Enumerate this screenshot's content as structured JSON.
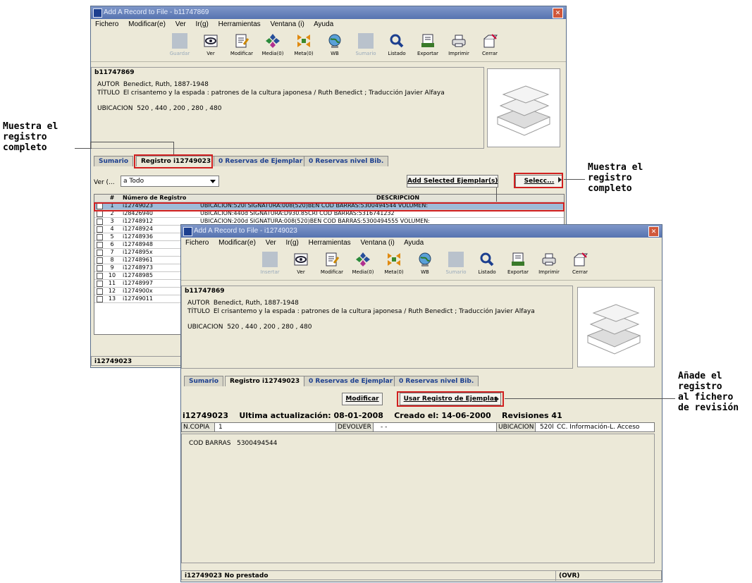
{
  "window1": {
    "title": "Add A Record to File - b11747869",
    "menu": [
      "Fichero",
      "Modificar(e)",
      "Ver",
      "Ir(g)",
      "Herramientas",
      "Ventana (i)",
      "Ayuda"
    ],
    "toolbar": [
      "Guardar",
      "Ver",
      "Modificar",
      "Media(0)",
      "Meta(0)",
      "WB",
      "Sumario",
      "Listado",
      "Exportar",
      "Imprimir",
      "Cerrar"
    ],
    "record_id": "b11747869",
    "autor_label": "AUTOR",
    "autor": "Benedict, Ruth, 1887-1948",
    "titulo_label": "TÍTULO",
    "titulo": "El crisantemo y la espada : patrones de la cultura japonesa / Ruth Benedict ; Traducción Javier Alfaya",
    "ubicacion_label": "UBICACION",
    "ubicacion": "520 , 440 , 200 , 280 , 480",
    "tabs": [
      "Sumario",
      "Registro i12749023",
      "0 Reservas de Ejemplar",
      "0 Reservas nivel Bib."
    ],
    "view_label": "Ver (...",
    "view_value": "a Todo",
    "add_button": "Add Selected Ejemplar(s)",
    "select_button": "Selecc...",
    "table_headers": {
      "num": "#",
      "record": "Número de Registro",
      "desc": "DESCRIPCION"
    },
    "rows": [
      {
        "num": "1",
        "record": "i12749023",
        "desc": "UBICACION:520l  SIGNATURA:008(520)BEN COD BARRAS:5300494544 VOLUMEN:"
      },
      {
        "num": "2",
        "record": "i28426940",
        "desc": "UBICACION:440d  SIGNATURA:D930.85CRI COD BARRAS:5316741232"
      },
      {
        "num": "3",
        "record": "i12748912",
        "desc": "UBICACION:200d  SIGNATURA:008(520)BEN COD BARRAS:5300494555 VOLUMEN:"
      },
      {
        "num": "4",
        "record": "i12748924",
        "desc": ""
      },
      {
        "num": "5",
        "record": "i12748936",
        "desc": ""
      },
      {
        "num": "6",
        "record": "i12748948",
        "desc": ""
      },
      {
        "num": "7",
        "record": "i1274895x",
        "desc": ""
      },
      {
        "num": "8",
        "record": "i12748961",
        "desc": ""
      },
      {
        "num": "9",
        "record": "i12748973",
        "desc": ""
      },
      {
        "num": "10",
        "record": "i12748985",
        "desc": ""
      },
      {
        "num": "11",
        "record": "i12748997",
        "desc": ""
      },
      {
        "num": "12",
        "record": "i1274900x",
        "desc": ""
      },
      {
        "num": "13",
        "record": "i12749011",
        "desc": ""
      }
    ],
    "status": "i12749023"
  },
  "window2": {
    "title": "Add A Record to File - i12749023",
    "menu": [
      "Fichero",
      "Modificar(e)",
      "Ver",
      "Ir(g)",
      "Herramientas",
      "Ventana (i)",
      "Ayuda"
    ],
    "toolbar": [
      "Insertar",
      "Ver",
      "Modificar",
      "Media(0)",
      "Meta(0)",
      "WB",
      "Sumario",
      "Listado",
      "Exportar",
      "Imprimir",
      "Cerrar"
    ],
    "record_id": "b11747869",
    "autor_label": "AUTOR",
    "autor": "Benedict, Ruth, 1887-1948",
    "titulo_label": "TÍTULO",
    "titulo": "El crisantemo y la espada : patrones de la cultura japonesa / Ruth Benedict ; Traducción Javier Alfaya",
    "ubicacion_label": "UBICACION",
    "ubicacion": "520 , 440 , 200 , 280 , 480",
    "tabs": [
      "Sumario",
      "Registro i12749023",
      "0 Reservas de Ejemplar",
      "0 Reservas nivel Bib."
    ],
    "modify_button": "Modificar",
    "use_button": "Usar Registro de Ejemplar",
    "item_id": "i12749023",
    "last_update": "Ultima actualización: 08-01-2008",
    "created": "Creado el: 14-06-2000",
    "revisions": "Revisiones 41",
    "ncopia_label": "N.COPIA",
    "ncopia": "1",
    "devolver_label": "DEVOLVER",
    "devolver": "- -",
    "ubic_label": "UBICACION",
    "ubic_code": "520l",
    "ubic_name": "CC. Información-L. Acceso",
    "barcode_label": "COD BARRAS",
    "barcode": "5300494544",
    "status": "i12749023 No prestado",
    "status_right": "(OVR)"
  },
  "callouts": {
    "left": "Muestra el\nregistro\ncompleto",
    "right": "Muestra el\nregistro\ncompleto",
    "bottom": "Añade el\nregistro\nal fichero\nde revisión"
  }
}
